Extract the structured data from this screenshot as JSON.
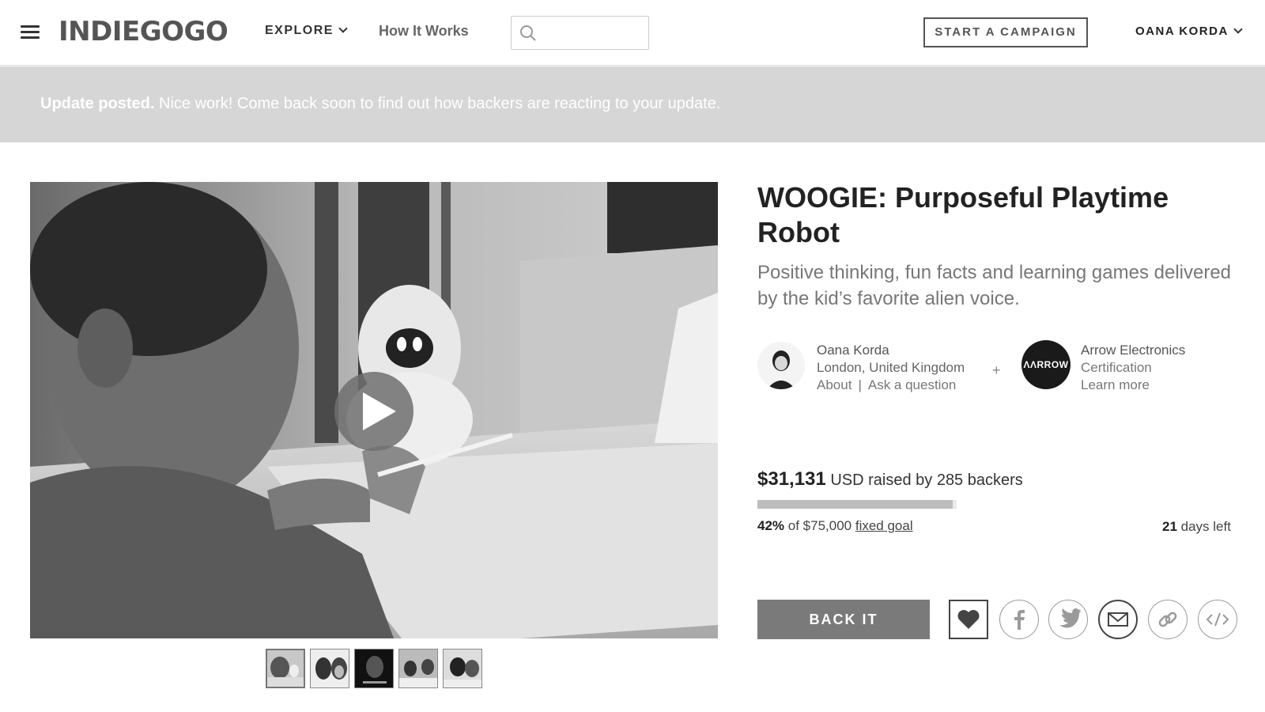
{
  "header": {
    "logo": "INDIEGOGO",
    "explore_label": "EXPLORE",
    "how_it_works_label": "How It Works",
    "search_value": "",
    "start_campaign_label": "START A CAMPAIGN",
    "user_name": "OANA KORDA"
  },
  "banner": {
    "bold": "Update posted.",
    "text": " Nice work! Come back soon to find out how backers are reacting to your update."
  },
  "media": {
    "thumbnail_count": 5,
    "active_thumbnail": 1
  },
  "campaign": {
    "title": "WOOGIE: Purposeful Playtime Robot",
    "tagline": "Positive thinking, fun facts and learning games delivered by the kid’s favorite alien voice."
  },
  "owner": {
    "name": "Oana Korda",
    "location": "London, United Kingdom",
    "about_link": "About",
    "separator": "|",
    "ask_link": "Ask a question"
  },
  "partner": {
    "plus": "+",
    "logo_text": "ΛΛRROW",
    "name": "Arrow Electronics",
    "role": "Certification",
    "learn_more": "Learn more"
  },
  "funding": {
    "amount": "$31,131",
    "raised_text": " USD raised by 285 backers",
    "progress_fraction": 0.42,
    "percent": "42%",
    "goal_text": " of $75,000 ",
    "goal_link": "fixed goal",
    "days_number": "21",
    "days_text": " days left"
  },
  "actions": {
    "back_it_label": "BACK IT",
    "icons": [
      "heart-icon",
      "facebook-icon",
      "twitter-icon",
      "email-icon",
      "link-icon",
      "embed-icon"
    ]
  },
  "colors": {
    "banner_bg": "#d6d6d6",
    "back_button_bg": "#7a7a7a",
    "progress_fill": "#bdbdbd"
  }
}
